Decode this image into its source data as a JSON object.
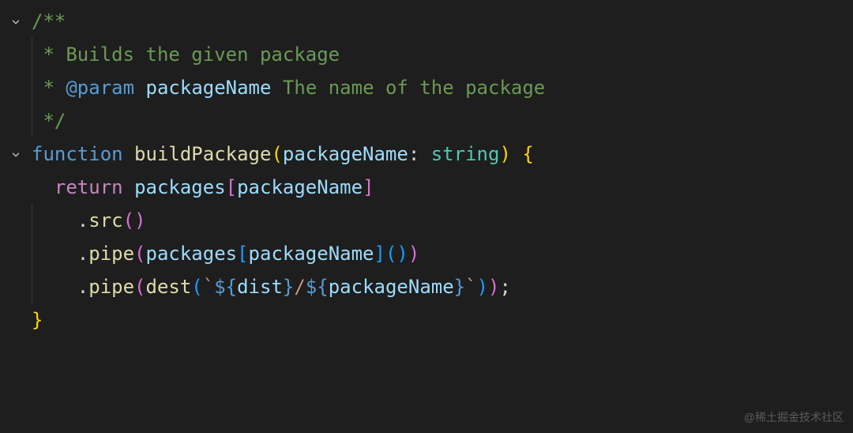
{
  "editor": {
    "lines": [
      {
        "fold": "open",
        "indent": 0,
        "tokens": [
          {
            "text": "/**",
            "cls": "comment-green"
          }
        ]
      },
      {
        "fold": "none",
        "indent": 0,
        "guide": true,
        "tokens": [
          {
            "text": " * Builds the given package",
            "cls": "comment-green"
          }
        ]
      },
      {
        "fold": "none",
        "indent": 0,
        "guide": true,
        "tokens": [
          {
            "text": " * ",
            "cls": "comment-green"
          },
          {
            "text": "@param",
            "cls": "keyword-blue"
          },
          {
            "text": " ",
            "cls": "comment-green"
          },
          {
            "text": "packageName",
            "cls": "var-lightblue"
          },
          {
            "text": " The name of the package",
            "cls": "comment-green"
          }
        ]
      },
      {
        "fold": "none",
        "indent": 0,
        "guide": true,
        "tokens": [
          {
            "text": " */",
            "cls": "comment-green"
          }
        ]
      },
      {
        "fold": "open",
        "indent": 0,
        "tokens": [
          {
            "text": "function",
            "cls": "keyword-blue"
          },
          {
            "text": " ",
            "cls": "punct"
          },
          {
            "text": "buildPackage",
            "cls": "func-yellow"
          },
          {
            "text": "(",
            "cls": "bracket-yellow"
          },
          {
            "text": "packageName",
            "cls": "var-lightblue"
          },
          {
            "text": ": ",
            "cls": "punct"
          },
          {
            "text": "string",
            "cls": "type-teal"
          },
          {
            "text": ")",
            "cls": "bracket-yellow"
          },
          {
            "text": " ",
            "cls": "punct"
          },
          {
            "text": "{",
            "cls": "bracket-yellow"
          }
        ]
      },
      {
        "fold": "none",
        "indent": 1,
        "tokens": [
          {
            "text": "return",
            "cls": "keyword-pink"
          },
          {
            "text": " ",
            "cls": "punct"
          },
          {
            "text": "packages",
            "cls": "var-lightblue"
          },
          {
            "text": "[",
            "cls": "bracket-pink"
          },
          {
            "text": "packageName",
            "cls": "var-lightblue"
          },
          {
            "text": "]",
            "cls": "bracket-pink"
          }
        ]
      },
      {
        "fold": "none",
        "indent": 2,
        "guide2": true,
        "tokens": [
          {
            "text": ".",
            "cls": "punct"
          },
          {
            "text": "src",
            "cls": "func-yellow"
          },
          {
            "text": "(",
            "cls": "bracket-pink"
          },
          {
            "text": ")",
            "cls": "bracket-pink"
          }
        ]
      },
      {
        "fold": "none",
        "indent": 2,
        "guide2": true,
        "tokens": [
          {
            "text": ".",
            "cls": "punct"
          },
          {
            "text": "pipe",
            "cls": "func-yellow"
          },
          {
            "text": "(",
            "cls": "bracket-pink"
          },
          {
            "text": "packages",
            "cls": "var-lightblue"
          },
          {
            "text": "[",
            "cls": "bracket-blue"
          },
          {
            "text": "packageName",
            "cls": "var-lightblue"
          },
          {
            "text": "]",
            "cls": "bracket-blue"
          },
          {
            "text": "(",
            "cls": "bracket-blue"
          },
          {
            "text": ")",
            "cls": "bracket-blue"
          },
          {
            "text": ")",
            "cls": "bracket-pink"
          }
        ]
      },
      {
        "fold": "none",
        "indent": 2,
        "guide2": true,
        "tokens": [
          {
            "text": ".",
            "cls": "punct"
          },
          {
            "text": "pipe",
            "cls": "func-yellow"
          },
          {
            "text": "(",
            "cls": "bracket-pink"
          },
          {
            "text": "dest",
            "cls": "func-yellow"
          },
          {
            "text": "(",
            "cls": "bracket-blue"
          },
          {
            "text": "`",
            "cls": "string-orange"
          },
          {
            "text": "${",
            "cls": "keyword-blue"
          },
          {
            "text": "dist",
            "cls": "var-lightblue"
          },
          {
            "text": "}",
            "cls": "keyword-blue"
          },
          {
            "text": "/",
            "cls": "string-orange"
          },
          {
            "text": "${",
            "cls": "keyword-blue"
          },
          {
            "text": "packageName",
            "cls": "var-lightblue"
          },
          {
            "text": "}",
            "cls": "keyword-blue"
          },
          {
            "text": "`",
            "cls": "string-orange"
          },
          {
            "text": ")",
            "cls": "bracket-blue"
          },
          {
            "text": ")",
            "cls": "bracket-pink"
          },
          {
            "text": ";",
            "cls": "punct"
          }
        ]
      },
      {
        "fold": "none",
        "indent": 0,
        "tokens": [
          {
            "text": "}",
            "cls": "bracket-yellow"
          }
        ]
      }
    ]
  },
  "watermark": "@稀土掘金技术社区",
  "colors": {
    "background": "#1e1e1e",
    "comment": "#6a9955",
    "keyword": "#569cd6",
    "function": "#dcdcaa",
    "variable": "#9cdcfe",
    "type": "#4ec9b0",
    "control": "#c586c0",
    "string": "#ce9178",
    "bracket1": "#ffd700",
    "bracket2": "#da70d6",
    "bracket3": "#179fff"
  }
}
